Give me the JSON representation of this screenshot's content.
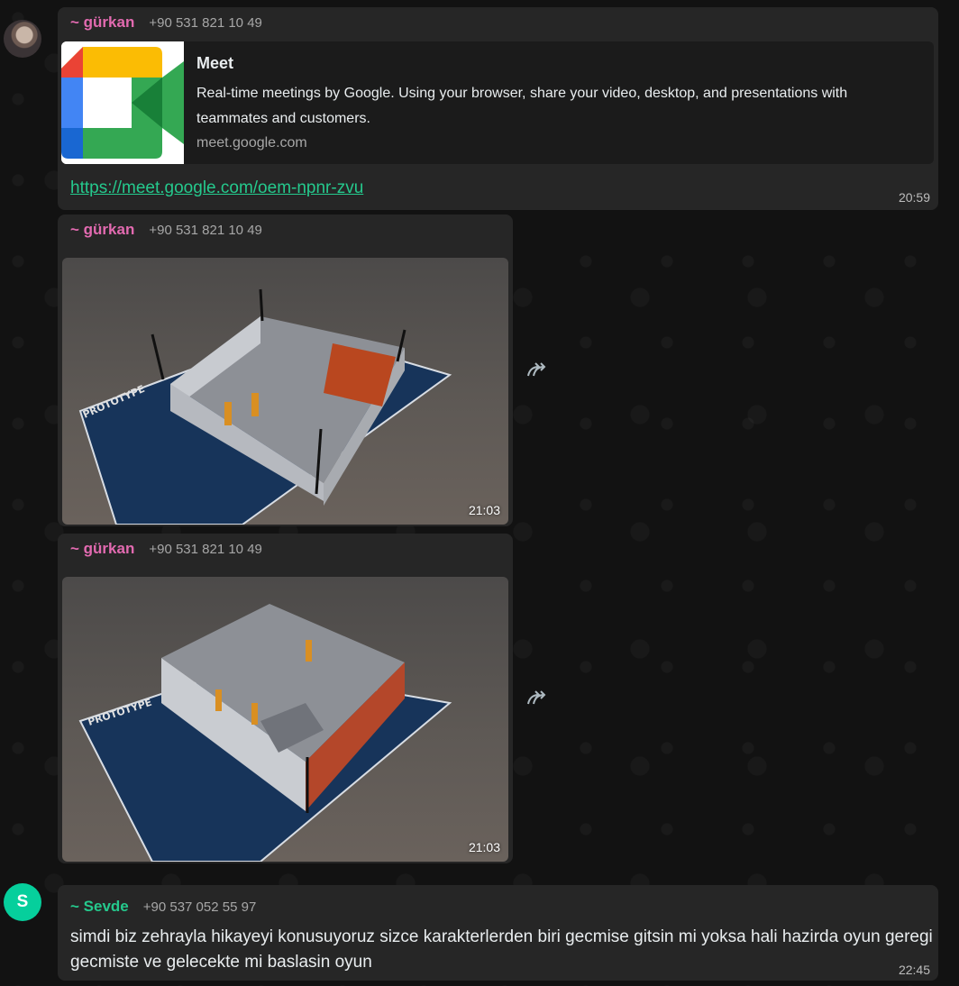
{
  "colors": {
    "sender_pink": "#e26ab0",
    "sender_green": "#25c98d",
    "link": "#25c98d",
    "bubble": "#262626"
  },
  "messages": [
    {
      "sender": "~ gürkan",
      "phone": "+90 531 821 10 49",
      "preview": {
        "title": "Meet",
        "description": "Real-time meetings by Google. Using your browser, share your video, desktop, and presentations with teammates and customers.",
        "domain": "meet.google.com"
      },
      "link": "https://meet.google.com/oem-npnr-zvu",
      "time": "20:59"
    },
    {
      "sender": "~ gürkan",
      "phone": "+90 531 821 10 49",
      "image": "unity-prototype-house-top-view",
      "time": "21:03"
    },
    {
      "sender": "~ gürkan",
      "phone": "+90 531 821 10 49",
      "image": "unity-prototype-house-angled-view",
      "time": "21:03"
    },
    {
      "avatar_letter": "S",
      "sender": "~ Sevde",
      "phone": "+90 537 052 55 97",
      "text": "simdi biz zehrayla hikayeyi konusuyoruz sizce karakterlerden biri gecmise gitsin mi yoksa hali hazirda oyun geregi gecmiste ve gelecekte mi baslasin oyun",
      "time": "22:45"
    }
  ],
  "icons": {
    "forward": "forward-icon"
  }
}
